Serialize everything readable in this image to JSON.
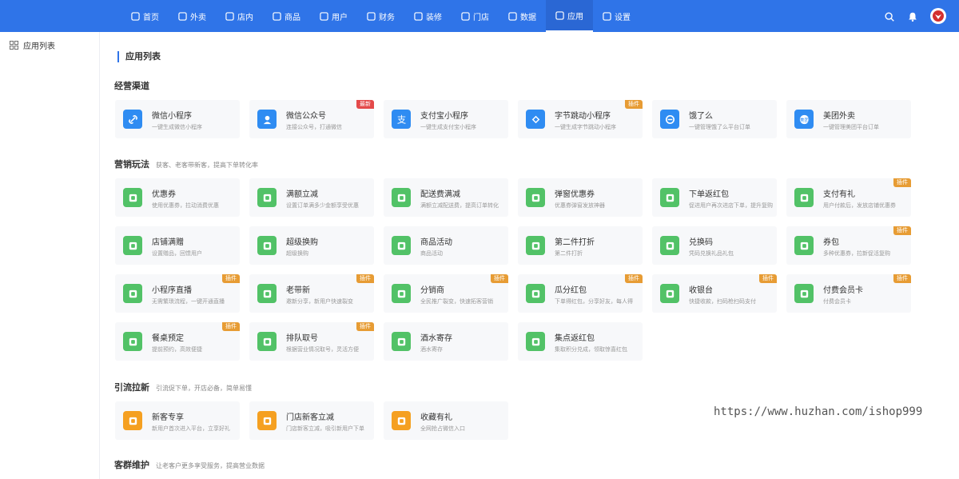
{
  "nav": {
    "items": [
      {
        "label": "首页",
        "icon": "home-icon"
      },
      {
        "label": "外卖",
        "icon": "delivery-icon"
      },
      {
        "label": "店内",
        "icon": "dine-in-icon"
      },
      {
        "label": "商品",
        "icon": "goods-icon"
      },
      {
        "label": "用户",
        "icon": "user-icon"
      },
      {
        "label": "财务",
        "icon": "finance-icon"
      },
      {
        "label": "装修",
        "icon": "decorate-icon"
      },
      {
        "label": "门店",
        "icon": "store-icon"
      },
      {
        "label": "数据",
        "icon": "chart-icon"
      },
      {
        "label": "应用",
        "icon": "apps-icon"
      },
      {
        "label": "设置",
        "icon": "settings-icon"
      }
    ],
    "active": "应用"
  },
  "sidebar": {
    "items": [
      {
        "label": "应用列表",
        "icon": "apps-icon"
      }
    ]
  },
  "page": {
    "title": "应用列表"
  },
  "sections": [
    {
      "title": "经营渠道",
      "subtitle": ""
    },
    {
      "title": "营销玩法",
      "subtitle": "获客、老客带新客，提高下单转化率"
    },
    {
      "title": "引流拉新",
      "subtitle": "引流促下单，开店必备，简单易懂"
    },
    {
      "title": "客群维护",
      "subtitle": "让老客户更多享受服务，提高营业数据"
    }
  ],
  "cards": [
    {
      "name": "微信小程序",
      "desc": "一键生成微信小程序",
      "color": "#2f8cf2",
      "icon": "link-icon",
      "badge": ""
    },
    {
      "name": "微信公众号",
      "desc": "连接公众号，打通微信",
      "color": "#2f8cf2",
      "icon": "person-icon",
      "badge": "最新"
    },
    {
      "name": "支付宝小程序",
      "desc": "一键生成支付宝小程序",
      "color": "#2f8cf2",
      "icon": "alipay-icon",
      "badge": ""
    },
    {
      "name": "字节跳动小程序",
      "desc": "一键生成字节跳动小程序",
      "color": "#2f8cf2",
      "icon": "bytedance-icon",
      "badge": "插件"
    },
    {
      "name": "饿了么",
      "desc": "一键管理饿了么平台订单",
      "color": "#2f8cf2",
      "icon": "eleme-icon",
      "badge": ""
    },
    {
      "name": "美团外卖",
      "desc": "一键管理美团平台订单",
      "color": "#2f8cf2",
      "icon": "meituan-icon",
      "badge": ""
    },
    {
      "name": "优惠券",
      "desc": "使用优惠券，拉动消费优惠",
      "color": "#52c267",
      "icon": "coupon-icon",
      "badge": ""
    },
    {
      "name": "满额立减",
      "desc": "设置订单满多少金额享受优惠",
      "color": "#52c267",
      "icon": "full-reduce-icon",
      "badge": ""
    },
    {
      "name": "配送费满减",
      "desc": "满额立减配送费，提高订单转化",
      "color": "#52c267",
      "icon": "tag-icon",
      "badge": ""
    },
    {
      "name": "弹窗优惠券",
      "desc": "优惠券弹窗发放神器",
      "color": "#52c267",
      "icon": "popup-coupon-icon",
      "badge": ""
    },
    {
      "name": "下单返红包",
      "desc": "促进用户再次进店下单，提升复购",
      "color": "#52c267",
      "icon": "red-packet-icon",
      "badge": ""
    },
    {
      "name": "支付有礼",
      "desc": "用户付款后，发放店铺优惠券",
      "color": "#52c267",
      "icon": "gift-icon",
      "badge": "插件"
    },
    {
      "name": "店铺满赠",
      "desc": "设置赠品，回馈用户",
      "color": "#52c267",
      "icon": "zeng-icon",
      "badge": ""
    },
    {
      "name": "超级换购",
      "desc": "超级换购",
      "color": "#52c267",
      "icon": "swap-icon",
      "badge": ""
    },
    {
      "name": "商品活动",
      "desc": "商品活动",
      "color": "#52c267",
      "icon": "megaphone-icon",
      "badge": ""
    },
    {
      "name": "第二件打折",
      "desc": "第二件打折",
      "color": "#52c267",
      "icon": "discount-tag-icon",
      "badge": ""
    },
    {
      "name": "兑换码",
      "desc": "凭码兑换礼品礼包",
      "color": "#52c267",
      "icon": "redeem-icon",
      "badge": ""
    },
    {
      "name": "券包",
      "desc": "多种优惠券，拉新促活复购",
      "color": "#52c267",
      "icon": "coupon-pack-icon",
      "badge": "插件"
    },
    {
      "name": "小程序直播",
      "desc": "无需繁琐流程，一键开通直播",
      "color": "#52c267",
      "icon": "live-icon",
      "badge": "插件"
    },
    {
      "name": "老带新",
      "desc": "邀新分享，新用户快速裂变",
      "color": "#52c267",
      "icon": "invite-icon",
      "badge": "插件"
    },
    {
      "name": "分销商",
      "desc": "全民推广裂变，快速拓客营销",
      "color": "#52c267",
      "icon": "image-icon",
      "badge": "插件"
    },
    {
      "name": "瓜分红包",
      "desc": "下单得红包，分享好友，每人得",
      "color": "#52c267",
      "icon": "split-packet-icon",
      "badge": "插件"
    },
    {
      "name": "收银台",
      "desc": "快捷收款，扫码枪扫码支付",
      "color": "#52c267",
      "icon": "cashier-icon",
      "badge": "插件"
    },
    {
      "name": "付费会员卡",
      "desc": "付费会员卡",
      "color": "#52c267",
      "icon": "vip-card-icon",
      "badge": "插件"
    },
    {
      "name": "餐桌预定",
      "desc": "提前预约，高效便捷",
      "color": "#52c267",
      "icon": "calendar-icon",
      "badge": "插件"
    },
    {
      "name": "排队取号",
      "desc": "根据营业情况取号，灵活方便",
      "color": "#52c267",
      "icon": "hourglass-icon",
      "badge": "插件"
    },
    {
      "name": "酒水寄存",
      "desc": "酒水寄存",
      "color": "#52c267",
      "icon": "save-icon",
      "badge": ""
    },
    {
      "name": "集点返红包",
      "desc": "集取积分兑成，领取惊喜红包",
      "color": "#52c267",
      "icon": "collect-icon",
      "badge": ""
    },
    {
      "name": "新客专享",
      "desc": "新用户首次进入平台，立享好礼",
      "color": "#f5a021",
      "icon": "new-customer-icon",
      "badge": ""
    },
    {
      "name": "门店新客立减",
      "desc": "门店新客立减，吸引新用户下单",
      "color": "#f5a021",
      "icon": "download-icon",
      "badge": ""
    },
    {
      "name": "收藏有礼",
      "desc": "全网抢占微信入口",
      "color": "#f5a021",
      "icon": "star-icon",
      "badge": ""
    }
  ],
  "watermark": "https://www.huzhan.com/ishop999"
}
